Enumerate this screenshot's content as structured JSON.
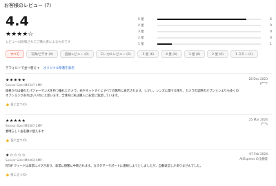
{
  "header": {
    "title": "お客様のレビュー (7)"
  },
  "summary": {
    "score": "4.4",
    "stars": "★★★★☆",
    "note": "レビューは投稿されてご購入者によるものです"
  },
  "distribution": [
    {
      "label": "5 星",
      "fraction": 0.86,
      "count": "6"
    },
    {
      "label": "4 星",
      "fraction": 0.0,
      "count": "0"
    },
    {
      "label": "3 星",
      "fraction": 0.0,
      "count": "0"
    },
    {
      "label": "2 星",
      "fraction": 0.0,
      "count": "0"
    },
    {
      "label": "1 星",
      "fraction": 0.14,
      "count": "1"
    }
  ],
  "filters": [
    {
      "label": "すべて",
      "active": true
    },
    {
      "label": "写真/ビデオ (0)",
      "active": false
    },
    {
      "label": "追加レビュー (0)",
      "active": false
    },
    {
      "label": "ローカルレビュー (0)",
      "active": false
    },
    {
      "label": "5 星 (6)",
      "active": false
    },
    {
      "label": "4 星 (0)",
      "active": false
    },
    {
      "label": "3 星 (0)",
      "active": false
    },
    {
      "label": "2 星 (0)",
      "active": false
    },
    {
      "label": "1 スター (1)",
      "active": false
    }
  ],
  "sort": {
    "label": "デフォルトで並べ替え ▾",
    "link": "オリジナル原著を表示"
  },
  "reviews": [
    {
      "stars": "★★★★★",
      "date": "28 Dec 2023",
      "user": "p***r",
      "sku": "Sensor Size:IMX347 4MP",
      "text": "価格からは優れたパフォーマンスを持つ優れたカメラ。光やネットすぐにすべての箇所に表示されます。しかし、レンズに関する限り、カメラの実際のオプションよりも多くのオプションがあればいいのにと思います。全体的に私は購入に非常に満足しています。",
      "helpful": "役に立つ(0)"
    },
    {
      "stars": "★★★★★",
      "date": "25 Mar 2024",
      "user": "J***s",
      "sku": "Sensor Size:IMX307 2MP",
      "text": "素晴らしく画を静に使えます",
      "helpful": "役に立つ(0)"
    },
    {
      "stars": "★☆☆☆☆",
      "date": "07 Feb 2024",
      "user": "AliExpress の全顧客",
      "sku": "Sensor Size:IMX464 6MP",
      "text": "RTSP フィードは非常にバグがあり、非常に頻繁に中断されます。カスタマーサポートに連絡しようとしましたが、自動返信しかありませんでした。",
      "helpful": "役に立つ(0)"
    }
  ]
}
